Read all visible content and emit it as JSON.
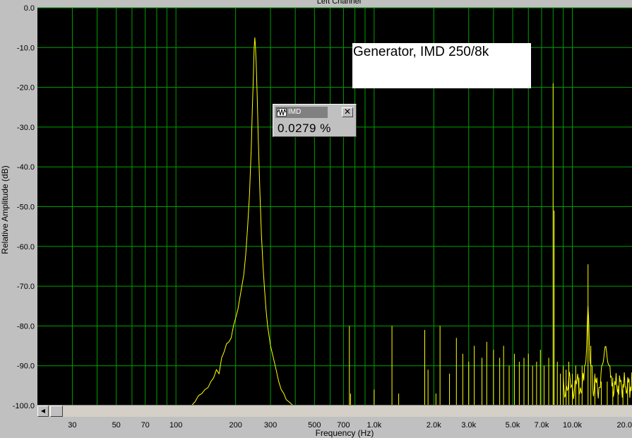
{
  "chart_data": {
    "type": "line",
    "title": "Left Channel",
    "xlabel": "Frequency (Hz)",
    "ylabel": "Relative Amplitude (dB)",
    "x_scale": "log",
    "xlim": [
      20,
      20000
    ],
    "ylim": [
      -100,
      0
    ],
    "grid": true,
    "y_ticks": [
      0,
      -10,
      -20,
      -30,
      -40,
      -50,
      -60,
      -70,
      -80,
      -90,
      -100
    ],
    "y_tick_labels": [
      "0.0",
      "-10.0",
      "-20.0",
      "-30.0",
      "-40.0",
      "-50.0",
      "-60.0",
      "-70.0",
      "-80.0",
      "-90.0",
      "-100.0"
    ],
    "x_ticks": [
      30,
      50,
      70,
      100,
      200,
      300,
      500,
      700,
      1000,
      2000,
      3000,
      5000,
      7000,
      10000,
      20000
    ],
    "x_tick_labels": [
      "30",
      "50",
      "70",
      "100",
      "200",
      "300",
      "500",
      "700",
      "1.0k",
      "2.0k",
      "3.0k",
      "5.0k",
      "7.0k",
      "10.0k",
      "20.0k"
    ],
    "series": [
      {
        "color": "#ffff00",
        "x": [
          120,
          125,
          130,
          135,
          140,
          145,
          150,
          155,
          160,
          165,
          170,
          175,
          180,
          185,
          190,
          195,
          200,
          205,
          210,
          215,
          220,
          225,
          230,
          235,
          240,
          243,
          246,
          248,
          250,
          252,
          254,
          257,
          260,
          265,
          270,
          275,
          280,
          285,
          290,
          300,
          310,
          320,
          330,
          340,
          350,
          360,
          370,
          380,
          390,
          400
        ],
        "y": [
          -100,
          -99,
          -97.5,
          -97,
          -96,
          -95.5,
          -94,
          -93,
          -91,
          -92,
          -88,
          -86.5,
          -84.5,
          -84,
          -83,
          -80,
          -78,
          -76,
          -73,
          -70,
          -67,
          -62,
          -55,
          -47,
          -35,
          -25,
          -17,
          -10,
          -7.5,
          -10,
          -14,
          -22,
          -32,
          -46,
          -57,
          -65,
          -71,
          -76,
          -80,
          -85,
          -88,
          -91,
          -94,
          -96,
          -97,
          -98.5,
          -99,
          -99.5,
          -100,
          -100
        ]
      }
    ],
    "annotations": [
      {
        "text": "Generator, IMD 250/8k"
      },
      {
        "widget_title": "IMD",
        "value": "0.0279 %"
      }
    ]
  }
}
